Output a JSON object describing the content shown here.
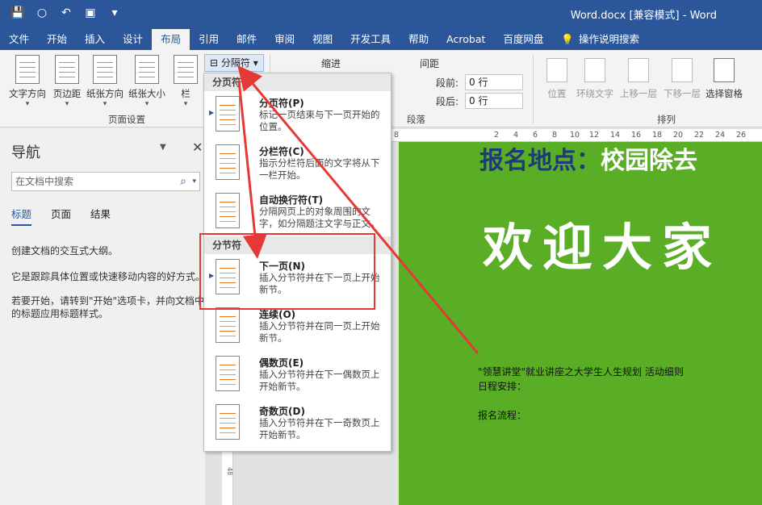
{
  "titlebar": {
    "doc_title": "Word.docx [兼容模式] - Word"
  },
  "qat": {
    "save": "save-icon",
    "undo": "undo-icon",
    "customize": "customize-icon"
  },
  "tabs": [
    "文件",
    "开始",
    "插入",
    "设计",
    "布局",
    "引用",
    "邮件",
    "审阅",
    "视图",
    "开发工具",
    "帮助",
    "Acrobat",
    "百度网盘",
    "操作说明搜索"
  ],
  "active_tab": "布局",
  "ribbon": {
    "page_setup": {
      "buttons": [
        "文字方向",
        "页边距",
        "纸张方向",
        "纸张大小",
        "栏"
      ],
      "label": "页面设置",
      "breaks_button": "分隔符"
    },
    "paragraph": {
      "indent_label": "缩进",
      "spacing_label": "间距",
      "before_label": "段前:",
      "after_label": "段后:",
      "before_value": "0 行",
      "after_value": "0 行",
      "label": "段落"
    },
    "arrange": {
      "buttons": [
        "位置",
        "环绕文字",
        "上移一层",
        "下移一层",
        "选择窗格"
      ],
      "label": "排列"
    }
  },
  "nav": {
    "title": "导航",
    "search_placeholder": "在文档中搜索",
    "tabs": [
      "标题",
      "页面",
      "结果"
    ],
    "text1": "创建文档的交互式大纲。",
    "text2": "它是跟踪具体位置或快速移动内容的好方式。",
    "text3": "若要开始，请转到\"开始\"选项卡，并向文档中的标题应用标题样式。"
  },
  "hruler_ticks": [
    "8",
    "2",
    "4",
    "6",
    "8",
    "10",
    "12",
    "14",
    "16",
    "18",
    "20",
    "22",
    "24",
    "26"
  ],
  "vruler_ticks": [
    "48"
  ],
  "menu": {
    "section1": "分页符",
    "section2": "分节符",
    "items": [
      {
        "name": "分页符(P)",
        "desc": "标记一页结束与下一页开始的位置。"
      },
      {
        "name": "分栏符(C)",
        "desc": "指示分栏符后面的文字将从下一栏开始。"
      },
      {
        "name": "自动换行符(T)",
        "desc": "分隔网页上的对象周围的文字，如分隔题注文字与正文。"
      },
      {
        "name": "下一页(N)",
        "desc": "插入分节符并在下一页上开始新节。"
      },
      {
        "name": "连续(O)",
        "desc": "插入分节符并在同一页上开始新节。"
      },
      {
        "name": "偶数页(E)",
        "desc": "插入分节符并在下一偶数页上开始新节。"
      },
      {
        "name": "奇数页(D)",
        "desc": "插入分节符并在下一奇数页上开始新节。"
      }
    ]
  },
  "document": {
    "heading_part1": "报名地点：",
    "heading_part2": "校园除去",
    "big_text": "欢迎大家",
    "line1": "\"领慧讲堂\"就业讲座之大学生人生规划 活动细则",
    "line2": "日程安排：",
    "line3": "报名流程："
  },
  "colors": {
    "accent": "#2b579a",
    "page_bg": "#5aae25",
    "arrow": "#e53935"
  }
}
